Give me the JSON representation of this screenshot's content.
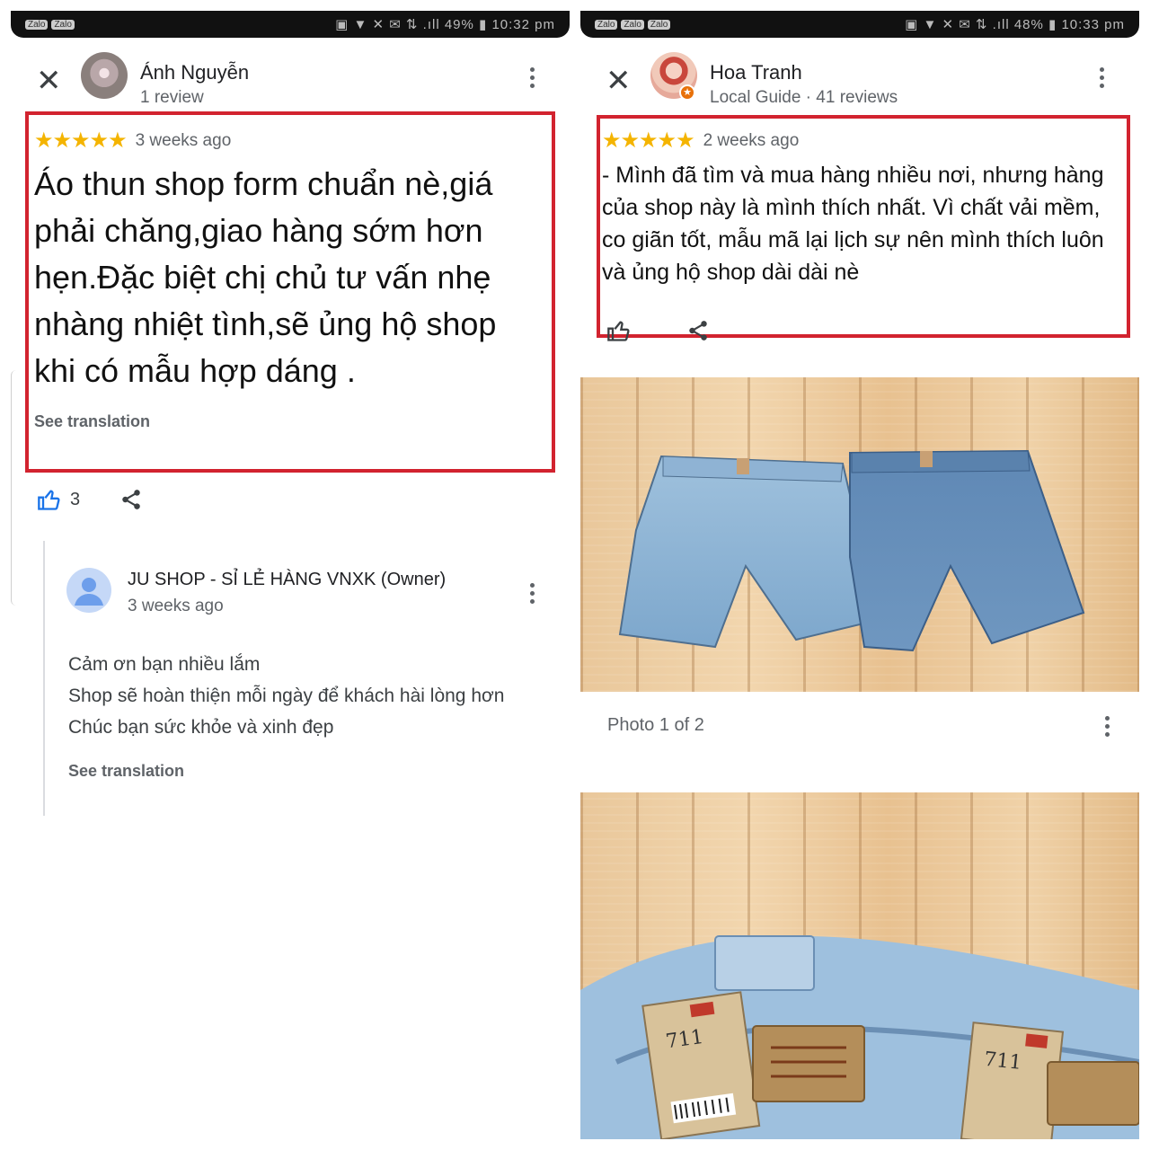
{
  "left": {
    "status": {
      "apps": [
        "Zalo",
        "Zalo"
      ],
      "right": "▣ ▼ ✕ ✉ ⇅ .ıll 49% ▮ 10:32 pm"
    },
    "author": "Ánh Nguyễn",
    "author_meta": "1 review",
    "rating_stars": "★★★★★",
    "time_ago": "3 weeks ago",
    "review_text": "Áo thun shop form chuẩn nè,giá phải chăng,giao hàng sớm hơn hẹn.Đặc biệt chị chủ tư vấn nhẹ nhàng nhiệt tình,sẽ ủng hộ shop khi có mẫu hợp dáng .",
    "see_translation": "See translation",
    "like_count": "3",
    "owner": {
      "name": "JU SHOP - SỈ LẺ HÀNG VNXK (Owner)",
      "time_ago": "3 weeks ago",
      "reply_lines": [
        "Cảm ơn bạn nhiều lắm",
        "Shop sẽ hoàn thiện mỗi ngày để khách hài lòng hơn",
        "Chúc bạn sức khỏe và xinh đẹp"
      ],
      "see_translation": "See translation"
    }
  },
  "right": {
    "status": {
      "apps": [
        "Zalo",
        "Zalo",
        "Zalo"
      ],
      "right": "▣ ▼ ✕ ✉ ⇅ .ıll 48% ▮ 10:33 pm"
    },
    "author": "Hoa Tranh",
    "author_meta": "Local Guide · 41 reviews",
    "rating_stars": "★★★★★",
    "time_ago": "2 weeks ago",
    "review_text": "- Mình đã tìm và mua hàng nhiều nơi, nhưng hàng của shop này là mình thích nhất. Vì chất vải mềm, co giãn tốt, mẫu mã lại lịch sự nên mình thích luôn và ủng hộ shop dài dài nè",
    "photo_caption": "Photo 1 of 2"
  },
  "colors": {
    "highlight": "#d2232f",
    "star": "#f4b400",
    "like_blue": "#1a73e8"
  },
  "icons": [
    "close-icon",
    "more-vert-icon",
    "thumb-up-icon",
    "share-icon",
    "person-icon",
    "local-guide-badge-icon"
  ]
}
